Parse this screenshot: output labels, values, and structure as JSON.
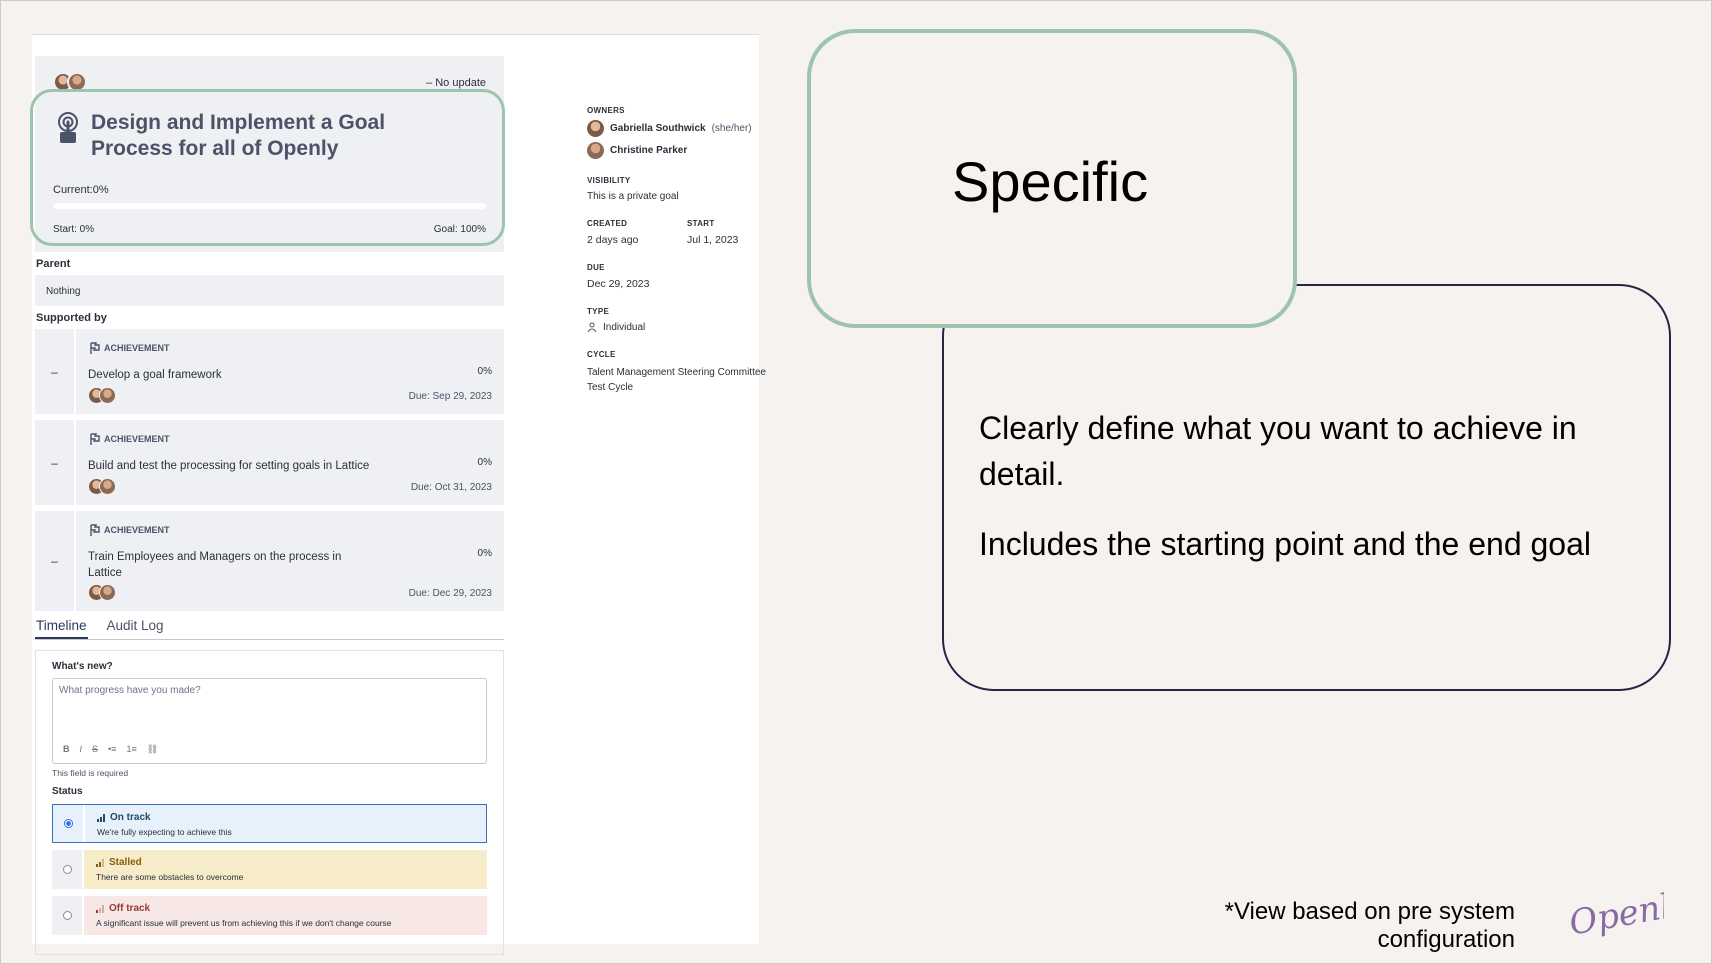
{
  "goal": {
    "no_update": "No update",
    "title": "Design and Implement a Goal Process for all of Openly",
    "current": "Current:0%",
    "progress_fraction": 0,
    "start": "Start: 0%",
    "goal_value": "Goal: 100%"
  },
  "parent": {
    "label": "Parent",
    "value": "Nothing"
  },
  "supported_by": {
    "label": "Supported by",
    "items": [
      {
        "collapse": "–",
        "type": "ACHIEVEMENT",
        "title": "Develop a goal framework",
        "pct": "0%",
        "due": "Due: Sep 29, 2023"
      },
      {
        "collapse": "–",
        "type": "ACHIEVEMENT",
        "title": "Build and test the processing for setting goals in Lattice",
        "pct": "0%",
        "due": "Due: Oct 31, 2023"
      },
      {
        "collapse": "–",
        "type": "ACHIEVEMENT",
        "title": "Train Employees and Managers on the process in Lattice",
        "pct": "0%",
        "due": "Due: Dec 29, 2023"
      }
    ]
  },
  "tabs": {
    "timeline": "Timeline",
    "audit": "Audit Log"
  },
  "timeline": {
    "whats_new": "What's new?",
    "placeholder": "What progress have you made?",
    "toolbar": [
      "B",
      "I",
      "S",
      "•≡",
      "1≡",
      "⛓"
    ],
    "required": "This field is required",
    "status_label": "Status",
    "options": [
      {
        "name": "On track",
        "desc": "We're fully expecting to achieve this",
        "selected": true
      },
      {
        "name": "Stalled",
        "desc": "There are some obstacles to overcome",
        "selected": false
      },
      {
        "name": "Off track",
        "desc": "A significant issue will prevent us from achieving this if we don't change course",
        "selected": false
      }
    ]
  },
  "details": {
    "owners_label": "OWNERS",
    "owner1": "Gabriella Southwick",
    "owner1_pronoun": "(she/her)",
    "owner2": "Christine Parker",
    "visibility_label": "VISIBILITY",
    "visibility": "This is a private goal",
    "created_label": "CREATED",
    "created": "2 days ago",
    "start_label": "START",
    "start": "Jul 1, 2023",
    "due_label": "DUE",
    "due": "Dec 29, 2023",
    "type_label": "TYPE",
    "type": "Individual",
    "cycle_label": "CYCLE",
    "cycle": "Talent Management Steering Committee Test Cycle"
  },
  "slide": {
    "heading": "Specific",
    "desc1": "Clearly define what you want to achieve in detail.",
    "desc2": "Includes the starting point and the end goal",
    "footnote": "*View based on pre system configuration",
    "logo_text": "Openly"
  },
  "colors": {
    "highlight": "#9cc4ae",
    "bubble_border": "#2a2346",
    "title": "#4c5268",
    "background": "#f6f2ef"
  }
}
